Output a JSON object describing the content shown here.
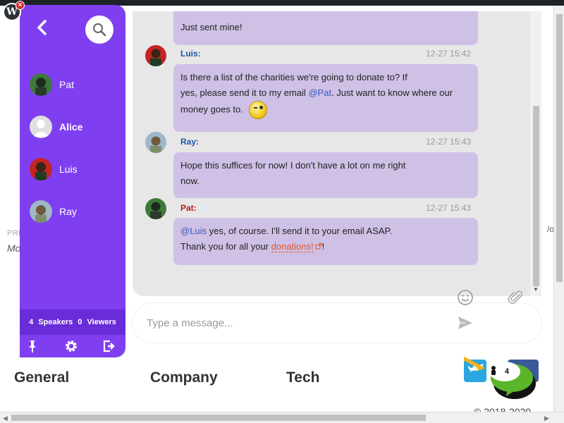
{
  "admin": {
    "logo": "W",
    "close": "×"
  },
  "page": {
    "pre_text": "PRE",
    "mo_text": "Mo",
    "right_text": "/o",
    "footer": [
      "General",
      "Company",
      "Tech"
    ],
    "copyright": "© 2018-2020"
  },
  "sidebar": {
    "back_icon": "chevron-left",
    "search_icon": "search",
    "users": [
      {
        "name": "Pat",
        "bold": false
      },
      {
        "name": "Alice",
        "bold": true
      },
      {
        "name": "Luis",
        "bold": false
      },
      {
        "name": "Ray",
        "bold": false
      }
    ],
    "status": {
      "speakers_count": "4",
      "speakers_label": "Speakers",
      "viewers_count": "0",
      "viewers_label": "Viewers"
    },
    "bottom_icons": [
      "pin-icon",
      "gear-icon",
      "logout-icon"
    ]
  },
  "chat": {
    "messages": [
      {
        "text": "Just sent mine!"
      },
      {
        "name": "Luis:",
        "name_color": "#1a56a8",
        "time": "12-27 15:42",
        "line1": "Is there a list of the charities we're going to donate to? If",
        "line2_a": "yes, please send it to my email ",
        "line2_mention": "@Pat",
        "line2_b": ". Just want to know where our",
        "line3": "money goes to."
      },
      {
        "name": "Ray:",
        "name_color": "#1a56a8",
        "time": "12-27 15:43",
        "line1": "Hope this suffices for now! I don't have a lot on me right",
        "line2": "now."
      },
      {
        "name": "Pat:",
        "name_color": "#b01c1c",
        "time": "12-27 15:43",
        "line1_mention": "@Luis",
        "line1": " yes, of course. I'll send it to your email ASAP.",
        "line2_a": "Thank you for all your ",
        "line2_link": "donations!",
        "line2_b": "!"
      }
    ],
    "input_placeholder": "Type a message...",
    "counter": "4"
  }
}
